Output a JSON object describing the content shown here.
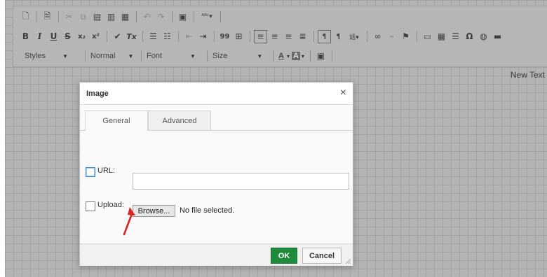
{
  "toolbar": {
    "row1": [
      "document-icon",
      "templates-icon",
      "cut-icon",
      "copy-icon",
      "paste-icon",
      "paste-text-icon",
      "paste-word-icon",
      "undo-icon",
      "redo-icon",
      "find-icon",
      "spellcheck-icon"
    ],
    "row2_labels": {
      "bold": "B",
      "italic": "I",
      "underline": "U",
      "strike": "S",
      "subscript": "x₂",
      "superscript": "x²",
      "remove_format": "Tx",
      "blockquote": "99",
      "special_char": "Ω"
    },
    "styles_label": "Styles",
    "format_label": "Normal",
    "font_label": "Font",
    "size_label": "Size",
    "text_color_label": "A",
    "bg_color_label": "A"
  },
  "editor": {
    "content_text": "New Text"
  },
  "dialog": {
    "title": "Image",
    "close_label": "×",
    "tabs": [
      {
        "label": "General",
        "active": true
      },
      {
        "label": "Advanced",
        "active": false
      }
    ],
    "url_label": "URL:",
    "url_value": "",
    "upload_label": "Upload:",
    "browse_label": "Browse...",
    "file_status": "No file selected.",
    "ok_label": "OK",
    "cancel_label": "Cancel"
  },
  "colors": {
    "ok_button": "#1e8a3d",
    "arrow": "#e02020",
    "focus": "#3a8bd0"
  }
}
